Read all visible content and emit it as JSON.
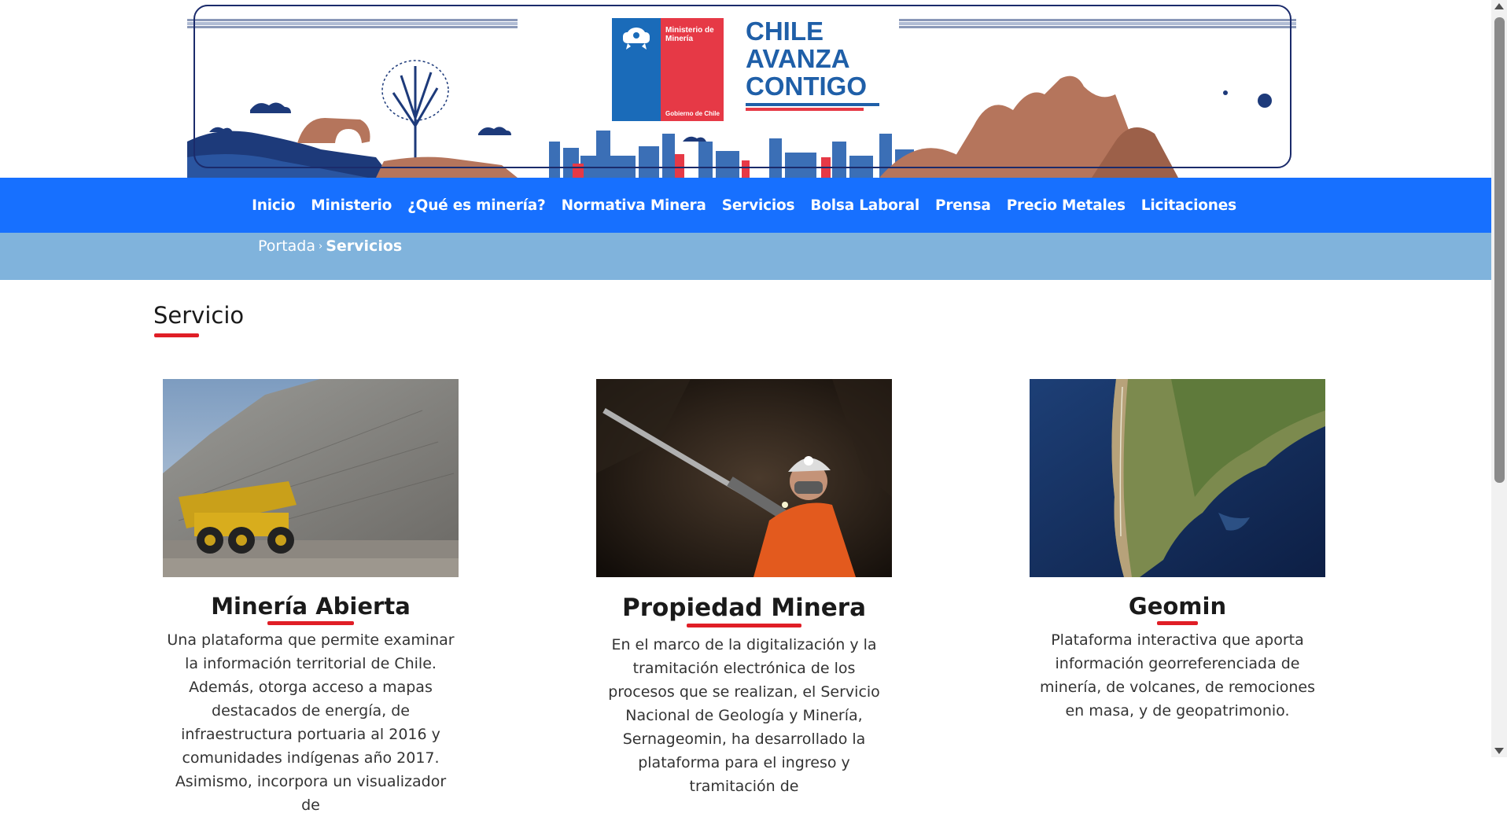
{
  "brand": {
    "ministry": "Ministerio de Minería",
    "government": "Gobierno de Chile",
    "slogan": [
      "CHILE",
      "AVANZA",
      "CONTIGO"
    ]
  },
  "nav": {
    "items": [
      {
        "label": "Inicio"
      },
      {
        "label": "Ministerio"
      },
      {
        "label": "¿Qué es minería?"
      },
      {
        "label": "Normativa Minera"
      },
      {
        "label": "Servicios"
      },
      {
        "label": "Bolsa Laboral"
      },
      {
        "label": "Prensa"
      },
      {
        "label": "Precio Metales"
      },
      {
        "label": "Licitaciones"
      }
    ]
  },
  "breadcrumb": {
    "home": "Portada",
    "separator": "›",
    "current": "Servicios"
  },
  "page": {
    "title": "Servicio"
  },
  "cards": [
    {
      "title": "Minería Abierta",
      "image_alt": "haul-truck-open-pit-mine",
      "description": "Una plataforma que permite examinar la información territorial de Chile. Además, otorga acceso a mapas destacados de energía, de infraestructura portuaria al 2016 y comunidades indígenas año 2017. Asimismo, incorpora un visualizador de"
    },
    {
      "title": "Propiedad Minera",
      "image_alt": "miner-with-drill-underground",
      "description": "En el marco de la digitalización y la tramitación electrónica de los procesos que se realizan, el Servicio Nacional de Geología y Minería, Sernageomin, ha desarrollado la plataforma para el ingreso y tramitación de"
    },
    {
      "title": "Geomin",
      "image_alt": "satellite-map-of-chile",
      "description": "Plataforma interactiva que aporta información georreferenciada de minería, de volcanes, de remociones en masa, y de geopatrimonio."
    }
  ],
  "colors": {
    "nav": "#1770ff",
    "breadcrumb_bar": "#80b3dc",
    "accent_red": "#e01e26",
    "brand_blue": "#1a6bb9"
  }
}
